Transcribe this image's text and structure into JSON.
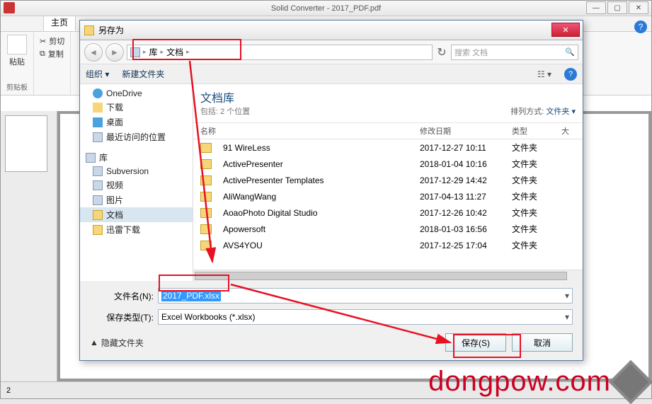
{
  "app": {
    "title": "Solid Converter - 2017_PDF.pdf",
    "winbtns": {
      "min": "—",
      "max": "▢",
      "close": "✕"
    }
  },
  "ribbon": {
    "tab_home": "主页",
    "paste": "粘贴",
    "cut": "剪切",
    "copy": "复制",
    "group_clipboard": "剪贴板"
  },
  "statusbar": {
    "page": "2"
  },
  "dialog": {
    "title": "另存为",
    "breadcrumb": {
      "a": "库",
      "b": "文档"
    },
    "search_placeholder": "搜索 文档",
    "organize": "组织",
    "newfolder": "新建文件夹",
    "tree": {
      "onedrive": "OneDrive",
      "downloads": "下载",
      "desktop": "桌面",
      "recent": "最近访问的位置",
      "library": "库",
      "subversion": "Subversion",
      "video": "视频",
      "pictures": "图片",
      "documents": "文档",
      "xunlei": "迅雷下载"
    },
    "lib": {
      "title": "文档库",
      "subtitle": "包括: 2 个位置",
      "sort_label": "排列方式:",
      "sort_value": "文件夹"
    },
    "cols": {
      "name": "名称",
      "date": "修改日期",
      "type": "类型",
      "size": "大"
    },
    "rows": [
      {
        "name": "91 WireLess",
        "date": "2017-12-27 10:11",
        "type": "文件夹"
      },
      {
        "name": "ActivePresenter",
        "date": "2018-01-04 10:16",
        "type": "文件夹"
      },
      {
        "name": "ActivePresenter Templates",
        "date": "2017-12-29 14:42",
        "type": "文件夹"
      },
      {
        "name": "AliWangWang",
        "date": "2017-04-13 11:27",
        "type": "文件夹"
      },
      {
        "name": "AoaoPhoto Digital Studio",
        "date": "2017-12-26 10:42",
        "type": "文件夹"
      },
      {
        "name": "Apowersoft",
        "date": "2018-01-03 16:56",
        "type": "文件夹"
      },
      {
        "name": "AVS4YOU",
        "date": "2017-12-25 17:04",
        "type": "文件夹"
      }
    ],
    "filename_label": "文件名(N):",
    "filename_value": "2017_PDF.xlsx",
    "filetype_label": "保存类型(T):",
    "filetype_value": "Excel Workbooks (*.xlsx)",
    "hide_folders": "隐藏文件夹",
    "save": "保存(S)",
    "cancel": "取消"
  },
  "watermark": "dongpow.com"
}
